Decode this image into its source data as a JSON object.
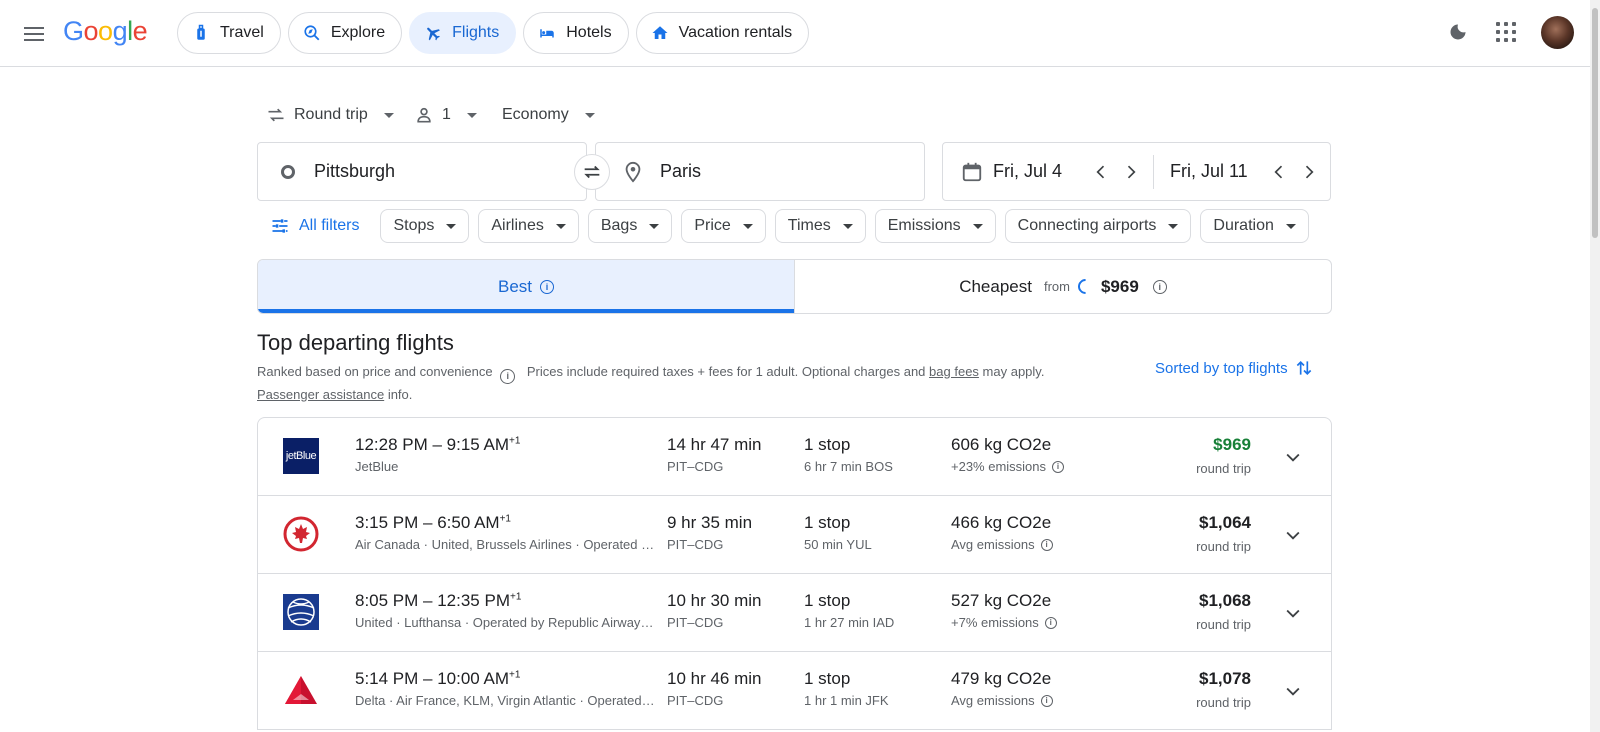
{
  "header": {
    "logo": {
      "G": "G",
      "o1": "o",
      "o2": "o",
      "g": "g",
      "l": "l",
      "e": "e"
    },
    "nav": [
      {
        "label": "Travel",
        "icon": "luggage-icon"
      },
      {
        "label": "Explore",
        "icon": "explore-icon"
      },
      {
        "label": "Flights",
        "icon": "airplane-icon",
        "active": true
      },
      {
        "label": "Hotels",
        "icon": "bed-icon"
      },
      {
        "label": "Vacation rentals",
        "icon": "house-icon"
      }
    ]
  },
  "search": {
    "trip_type": "Round trip",
    "passengers": "1",
    "cabin": "Economy",
    "origin": "Pittsburgh",
    "destination": "Paris",
    "depart_date": "Fri, Jul 4",
    "return_date": "Fri, Jul 11"
  },
  "filters": {
    "all_filters": "All filters",
    "chips": [
      "Stops",
      "Airlines",
      "Bags",
      "Price",
      "Times",
      "Emissions",
      "Connecting airports",
      "Duration"
    ]
  },
  "tabs": {
    "best": "Best",
    "cheapest": "Cheapest",
    "from": "from",
    "cheapest_price": "$969"
  },
  "results": {
    "title": "Top departing flights",
    "ranked": "Ranked based on price and convenience",
    "prices_note": "Prices include required taxes + fees for 1 adult. Optional charges and",
    "bag_fees": "bag fees",
    "may_apply": "may apply.",
    "passenger_assistance": "Passenger assistance",
    "info": "info.",
    "sorted_by": "Sorted by top flights",
    "round_trip": "round trip",
    "flights": [
      {
        "times": "12:28 PM – 9:15 AM",
        "plus": "+1",
        "airline": "JetBlue",
        "duration": "14 hr 47 min",
        "route": "PIT–CDG",
        "stops": "1 stop",
        "layover": "6 hr 7 min BOS",
        "co2": "606 kg CO2e",
        "emissions": "+23% emissions",
        "price": "$969",
        "logo": "jetblue-logo",
        "logo_text": "jetBlue"
      },
      {
        "times": "3:15 PM – 6:50 AM",
        "plus": "+1",
        "airline": "Air Canada · United, Brussels Airlines · Operated by Air Canada Express - Jazz",
        "duration": "9 hr 35 min",
        "route": "PIT–CDG",
        "stops": "1 stop",
        "layover": "50 min YUL",
        "co2": "466 kg CO2e",
        "emissions": "Avg emissions",
        "price": "$1,064",
        "logo": "air-canada-logo"
      },
      {
        "times": "8:05 PM – 12:35 PM",
        "plus": "+1",
        "airline": "United · Lufthansa · Operated by Republic Airways as United Express",
        "duration": "10 hr 30 min",
        "route": "PIT–CDG",
        "stops": "1 stop",
        "layover": "1 hr 27 min IAD",
        "co2": "527 kg CO2e",
        "emissions": "+7% emissions",
        "price": "$1,068",
        "logo": "united-logo"
      },
      {
        "times": "5:14 PM – 10:00 AM",
        "plus": "+1",
        "airline": "Delta · Air France, KLM, Virgin Atlantic · Operated by Endeavor Air DBA Delta Connection",
        "duration": "10 hr 46 min",
        "route": "PIT–CDG",
        "stops": "1 stop",
        "layover": "1 hr 1 min JFK",
        "co2": "479 kg CO2e",
        "emissions": "Avg emissions",
        "price": "$1,078",
        "logo": "delta-logo"
      }
    ]
  },
  "colors": {
    "accent": "#1a73e8",
    "active_chip_bg": "#e8f0fe",
    "price_green": "#188038"
  }
}
